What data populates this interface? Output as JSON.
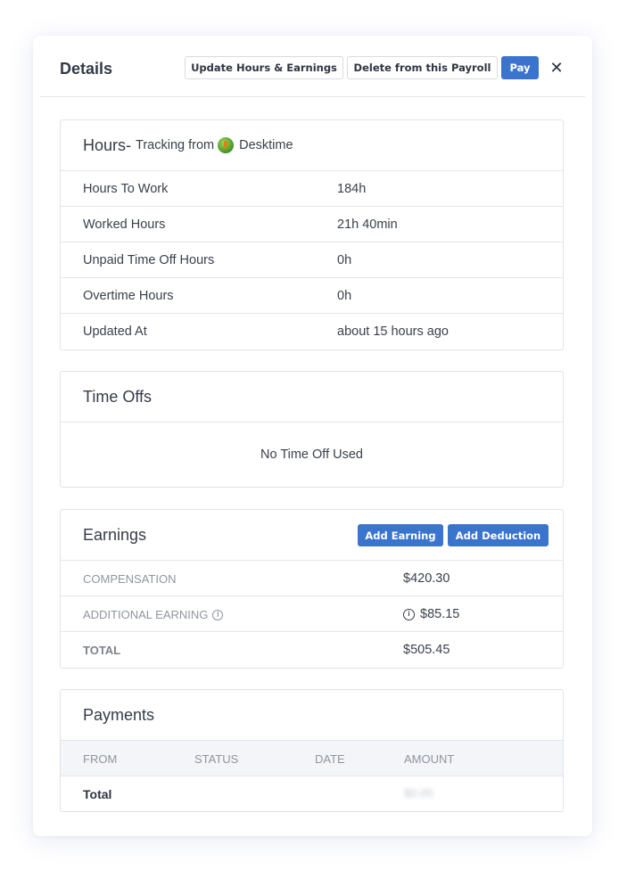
{
  "header": {
    "title": "Details",
    "update_label": "Update Hours & Earnings",
    "delete_label": "Delete from this Payroll",
    "pay_label": "Pay",
    "close_glyph": "✕"
  },
  "hours": {
    "title": "Hours-",
    "tracking_prefix": "Tracking from",
    "provider": "Desktime",
    "rows": [
      {
        "label": "Hours To Work",
        "value": "184h"
      },
      {
        "label": "Worked Hours",
        "value": "21h 40min"
      },
      {
        "label": "Unpaid Time Off Hours",
        "value": "0h"
      },
      {
        "label": "Overtime Hours",
        "value": "0h"
      },
      {
        "label": "Updated At",
        "value": "about 15 hours ago"
      }
    ]
  },
  "time_offs": {
    "title": "Time Offs",
    "empty_text": "No Time Off Used"
  },
  "earnings": {
    "title": "Earnings",
    "add_earning_label": "Add Earning",
    "add_deduction_label": "Add Deduction",
    "compensation_label": "COMPENSATION",
    "compensation_value": "$420.30",
    "additional_label": "ADDITIONAL EARNING",
    "additional_value": "$85.15",
    "total_label": "TOTAL",
    "total_value": "$505.45"
  },
  "payments": {
    "title": "Payments",
    "columns": [
      "FROM",
      "STATUS",
      "DATE",
      "AMOUNT"
    ],
    "total_label": "Total",
    "total_value": "$0.00"
  },
  "colors": {
    "primary": "#3b74cc",
    "border": "#e0e3e7",
    "muted_text": "#8f959e"
  }
}
